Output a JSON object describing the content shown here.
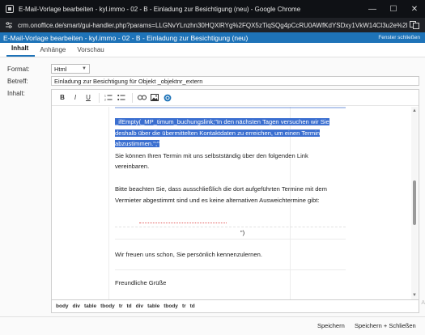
{
  "window": {
    "title": "E-Mail-Vorlage bearbeiten - kyl.immo - 02 - B - Einladung zur Besichtigung (neu) - Google Chrome",
    "controls": {
      "minimize": "—",
      "maximize": "☐",
      "close": "✕"
    }
  },
  "address_bar": {
    "url": "crm.onoffice.de/smart/gui-handler.php?params=LLGNvYLnzhn30HQXlRYg%2FQX5zTiqSQg4pCcRU0AWfKdYSDxy1VkW14Cl3u2e%2BeEKJy..."
  },
  "dialog": {
    "title": "E-Mail-Vorlage bearbeiten - kyl.immo - 02 - B - Einladung zur Besichtigung (neu)",
    "close_label": "Fenster schließen"
  },
  "tabs": [
    {
      "label": "Inhalt",
      "active": true
    },
    {
      "label": "Anhänge",
      "active": false
    },
    {
      "label": "Vorschau",
      "active": false
    }
  ],
  "form": {
    "format_label": "Format:",
    "format_value": "Html",
    "subject_label": "Betreff:",
    "subject_value": "Einladung zur Besichtigung für Objekt _objektnr_extern",
    "content_label": "Inhalt:"
  },
  "editor": {
    "toolbar": [
      {
        "name": "bold-button",
        "glyph": "B"
      },
      {
        "name": "italic-button",
        "glyph": "I"
      },
      {
        "name": "underline-button",
        "glyph": "U"
      }
    ],
    "selected_lines": [
      "_ifEmpty(_MP_timum_buchungslink;\"In den nächsten Tagen versuchen wir Sie",
      "deshalb über die übermittelten Kontaktdaten zu erreichen, um einen Termin",
      "abzustimmen.\";\""
    ],
    "paragraph1_lines": [
      "Sie können Ihren Termin mit uns selbstständig über den folgenden Link",
      "vereinbaren."
    ],
    "paragraph2_lines": [
      "Bitte beachten Sie, dass ausschließlich die dort aufgeführten Termine mit dem",
      "Vermieter abgestimmt sind und es keine alternativen Ausweichtermine gibt:"
    ],
    "link_close": "\")",
    "paragraph3": "Wir freuen uns schon, Sie persönlich kennenzulernen.",
    "closing": "Freundliche Grüße"
  },
  "statusbar": {
    "path": [
      "body",
      "div",
      "table",
      "tbody",
      "tr",
      "td",
      "div",
      "table",
      "tbody",
      "tr",
      "td"
    ]
  },
  "side_letter": "A",
  "footer": {
    "save_label": "Speichern",
    "save_close_label": "Speichern + Schließen"
  }
}
